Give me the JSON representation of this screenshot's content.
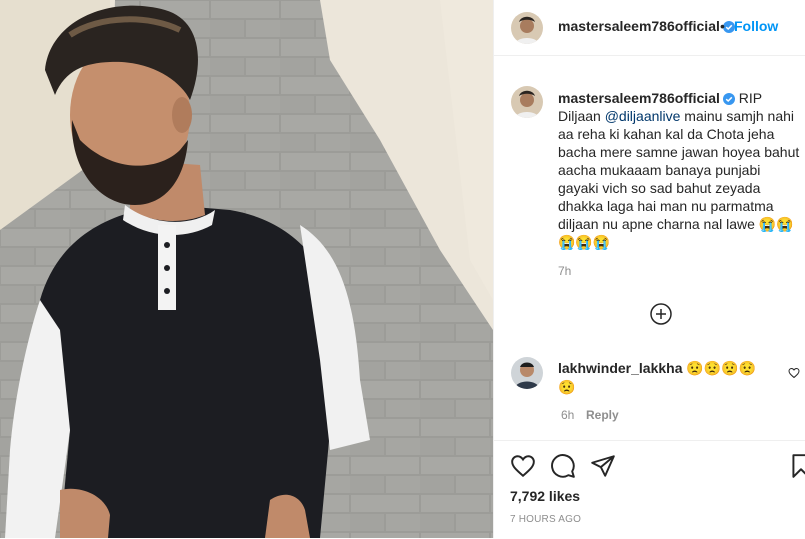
{
  "post": {
    "username": "mastersaleem786official",
    "follow_label": "Follow",
    "separator": "•"
  },
  "caption": {
    "username": "mastersaleem786official",
    "text_before": " RIP Diljaan ",
    "mention": "@diljaanlive",
    "text_after": " mainu samjh nahi aa reha ki kahan kal da Chota jeha bacha mere samne jawan hoyea bahut aacha mukaaam banaya punjabi gayaki vich so sad bahut zeyada dhakka laga hai man nu parmatma diljaan nu apne charna nal lawe 😭😭 😭😭😭",
    "time": "7h"
  },
  "comment": {
    "username": "lakhwinder_lakkha",
    "text": " 😟😟😟😟 😟",
    "time": "6h",
    "reply_label": "Reply"
  },
  "footer": {
    "likes": "7,792 likes",
    "posted": "7 HOURS AGO"
  },
  "icons": {
    "like": "heart-icon",
    "comment": "comment-icon",
    "share": "share-icon",
    "save": "bookmark-icon",
    "more_comments": "plus-circle-icon"
  },
  "colors": {
    "link": "#0095f6",
    "mention": "#00376b",
    "muted": "#8e8e8e"
  }
}
